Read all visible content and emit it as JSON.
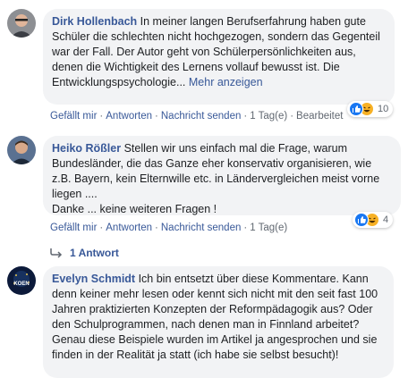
{
  "comments": [
    {
      "author": "Dirk Hollenbach",
      "text": "In meiner langen Berufserfahrung haben gute Schüler die schlechten nicht hochgezogen, sondern das Gegenteil war der Fall. Der Autor geht von Schülerpersönlichkeiten aus, denen die Wichtigkeit des Lernens vollauf bewusst ist. Die Entwicklungspsychologie...",
      "more": "Mehr anzeigen",
      "actions": {
        "like": "Gefällt mir",
        "reply": "Antworten",
        "message": "Nachricht senden",
        "time": "1 Tag(e)",
        "edited": "Bearbeitet"
      },
      "reaction_count": "10",
      "reactions": [
        "like-icon",
        "haha-icon"
      ]
    },
    {
      "author": "Heiko Rößler",
      "text": "Stellen wir uns einfach mal die Frage, warum Bundesländer, die das Ganze eher konservativ organisieren, wie z.B. Bayern, kein Elternwille etc. in Ländervergleichen meist vorne liegen ....",
      "text2": "Danke ... keine weiteren Fragen !",
      "actions": {
        "like": "Gefällt mir",
        "reply": "Antworten",
        "message": "Nachricht senden",
        "time": "1 Tag(e)"
      },
      "reaction_count": "4",
      "reactions": [
        "like-icon",
        "haha-icon"
      ],
      "replies_label": "1 Antwort"
    },
    {
      "author": "Evelyn Schmidt",
      "text": "Ich bin entsetzt über diese Kommentare. Kann denn keiner mehr lesen oder kennt sich nicht mit den seit fast 100 Jahren praktizierten Konzepten der Reformpädagogik aus? Oder den Schulprogrammen, nach denen man in Finnland arbeitet? Genau diese Beispiele wurden im Artikel ja angesprochen und sie finden in der Realität ja statt (ich habe sie selbst besucht)!",
      "avatar_text": "KOEN"
    }
  ],
  "colors": {
    "link": "#385898",
    "bubble": "#f2f3f5",
    "like": "#1877f2",
    "haha": "#f7b125"
  }
}
